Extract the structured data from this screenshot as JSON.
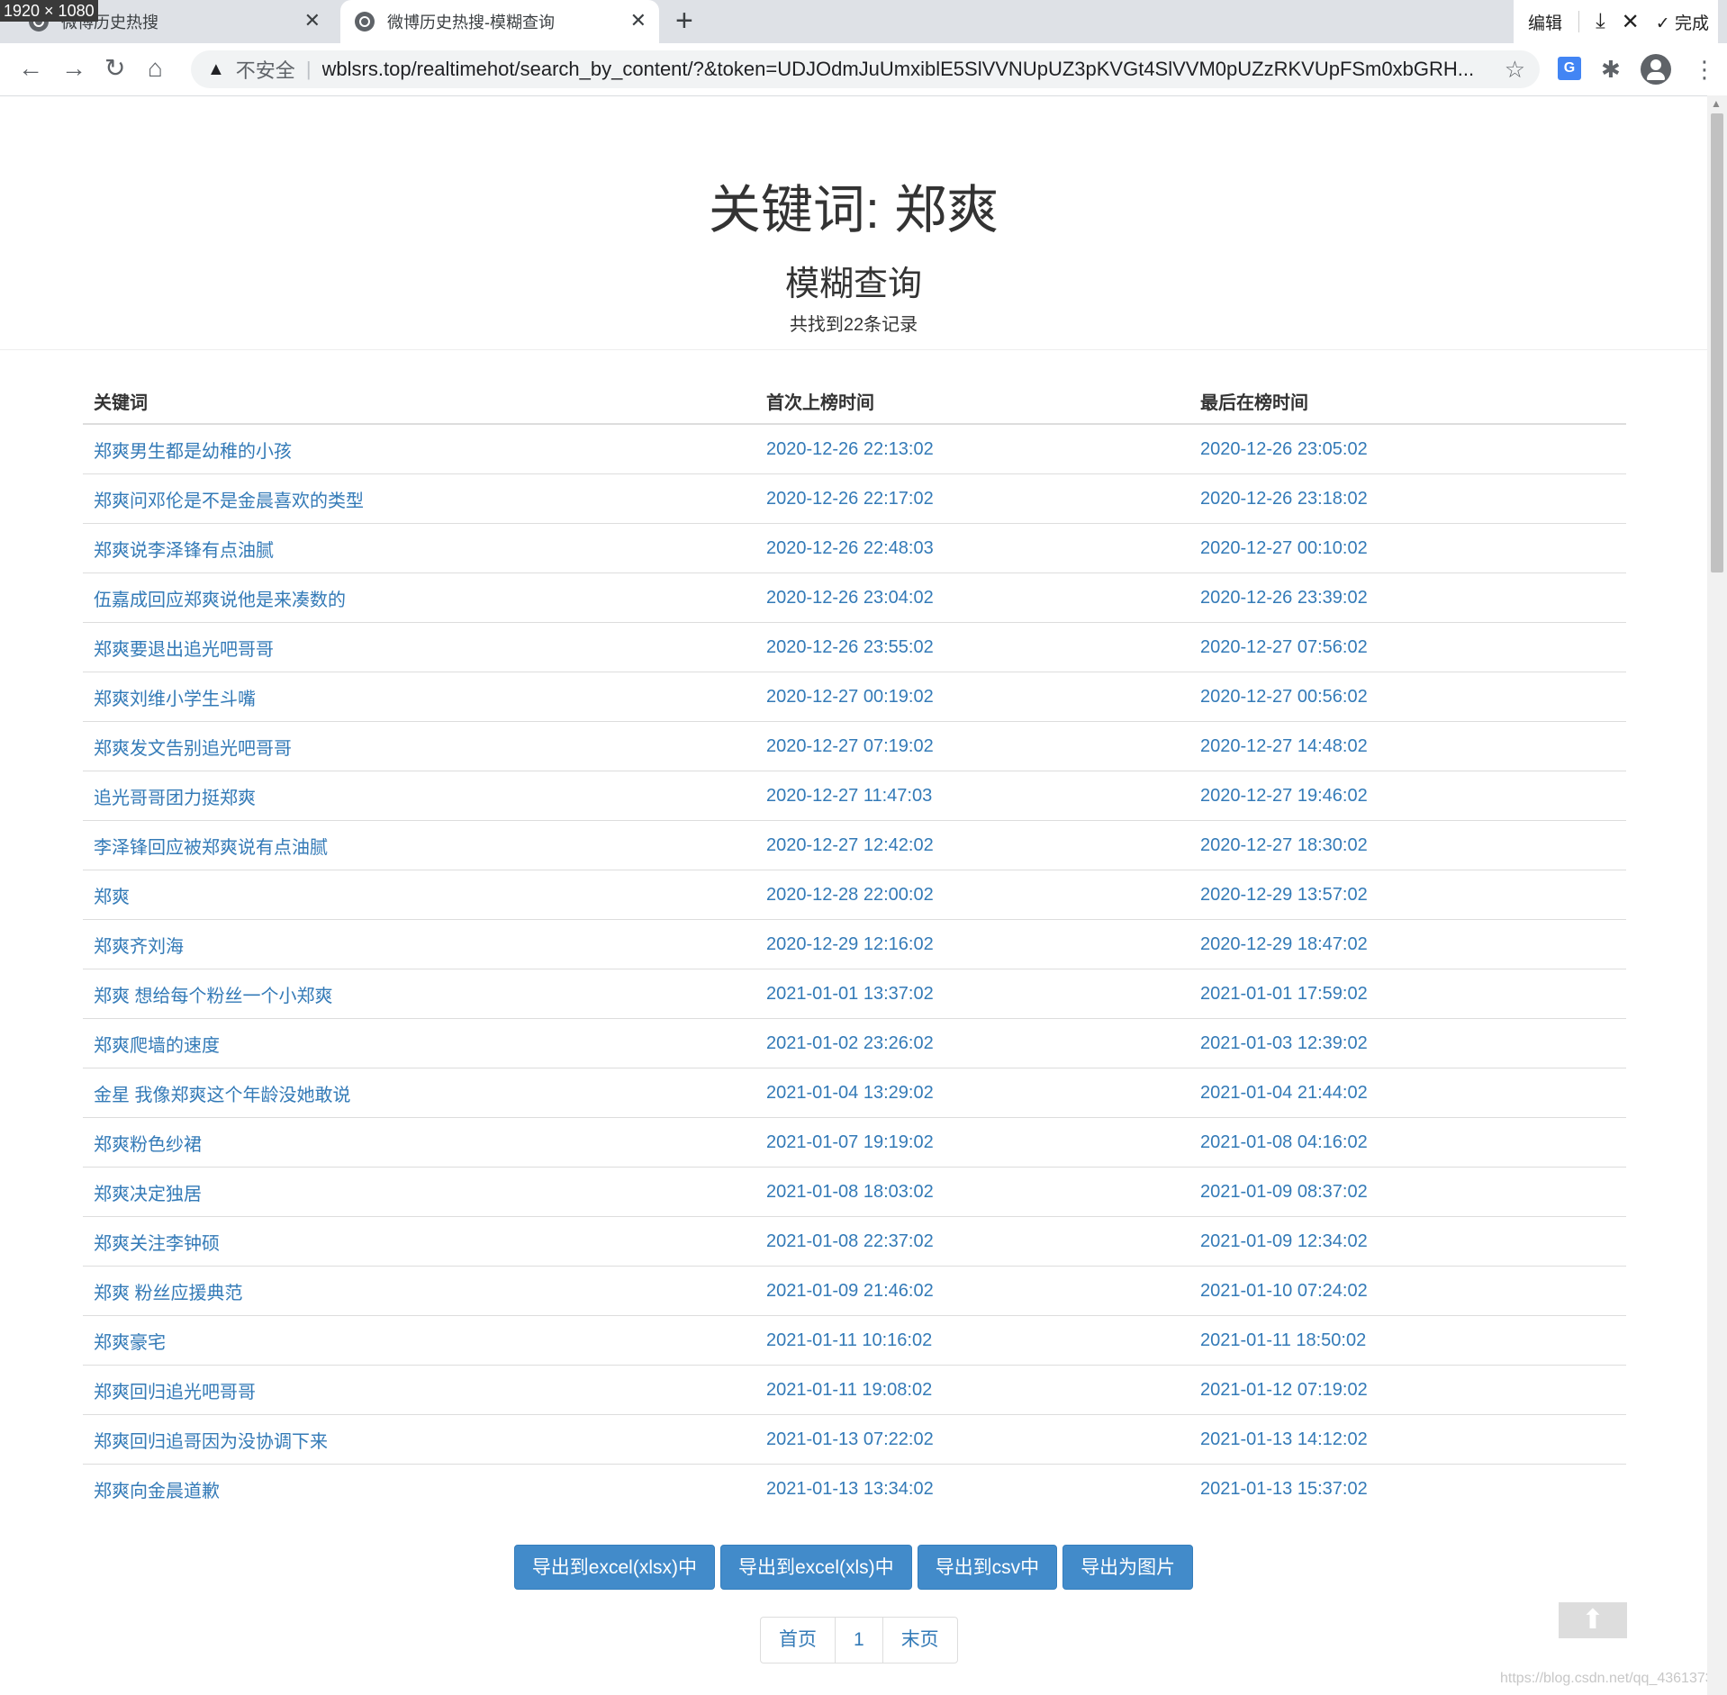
{
  "browser": {
    "dimension_badge": "1920 × 1080",
    "tabs": [
      {
        "title": "微博历史热搜",
        "active": false
      },
      {
        "title": "微博历史热搜-模糊查询",
        "active": true
      }
    ],
    "insecure_label": "不安全",
    "url": "wblsrs.top/realtimehot/search_by_content/?&token=UDJOdmJuUmxiblE5SlVVNUpUZ3pKVGt4SlVVM0pUZzRKVUpFSm0xbGRH...",
    "screenshot_tools": {
      "edit_label": "编辑",
      "done_label": "完成"
    }
  },
  "header": {
    "title": "关键词: 郑爽",
    "subtitle": "模糊查询",
    "record_count": "共找到22条记录"
  },
  "table": {
    "columns": [
      "关键词",
      "首次上榜时间",
      "最后在榜时间"
    ],
    "rows": [
      [
        "郑爽男生都是幼稚的小孩",
        "2020-12-26 22:13:02",
        "2020-12-26 23:05:02"
      ],
      [
        "郑爽问邓伦是不是金晨喜欢的类型",
        "2020-12-26 22:17:02",
        "2020-12-26 23:18:02"
      ],
      [
        "郑爽说李泽锋有点油腻",
        "2020-12-26 22:48:03",
        "2020-12-27 00:10:02"
      ],
      [
        "伍嘉成回应郑爽说他是来凑数的",
        "2020-12-26 23:04:02",
        "2020-12-26 23:39:02"
      ],
      [
        "郑爽要退出追光吧哥哥",
        "2020-12-26 23:55:02",
        "2020-12-27 07:56:02"
      ],
      [
        "郑爽刘维小学生斗嘴",
        "2020-12-27 00:19:02",
        "2020-12-27 00:56:02"
      ],
      [
        "郑爽发文告别追光吧哥哥",
        "2020-12-27 07:19:02",
        "2020-12-27 14:48:02"
      ],
      [
        "追光哥哥团力挺郑爽",
        "2020-12-27 11:47:03",
        "2020-12-27 19:46:02"
      ],
      [
        "李泽锋回应被郑爽说有点油腻",
        "2020-12-27 12:42:02",
        "2020-12-27 18:30:02"
      ],
      [
        "郑爽",
        "2020-12-28 22:00:02",
        "2020-12-29 13:57:02"
      ],
      [
        "郑爽齐刘海",
        "2020-12-29 12:16:02",
        "2020-12-29 18:47:02"
      ],
      [
        "郑爽 想给每个粉丝一个小郑爽",
        "2021-01-01 13:37:02",
        "2021-01-01 17:59:02"
      ],
      [
        "郑爽爬墙的速度",
        "2021-01-02 23:26:02",
        "2021-01-03 12:39:02"
      ],
      [
        "金星 我像郑爽这个年龄没她敢说",
        "2021-01-04 13:29:02",
        "2021-01-04 21:44:02"
      ],
      [
        "郑爽粉色纱裙",
        "2021-01-07 19:19:02",
        "2021-01-08 04:16:02"
      ],
      [
        "郑爽决定独居",
        "2021-01-08 18:03:02",
        "2021-01-09 08:37:02"
      ],
      [
        "郑爽关注李钟硕",
        "2021-01-08 22:37:02",
        "2021-01-09 12:34:02"
      ],
      [
        "郑爽 粉丝应援典范",
        "2021-01-09 21:46:02",
        "2021-01-10 07:24:02"
      ],
      [
        "郑爽豪宅",
        "2021-01-11 10:16:02",
        "2021-01-11 18:50:02"
      ],
      [
        "郑爽回归追光吧哥哥",
        "2021-01-11 19:08:02",
        "2021-01-12 07:19:02"
      ],
      [
        "郑爽回归追哥因为没协调下来",
        "2021-01-13 07:22:02",
        "2021-01-13 14:12:02"
      ],
      [
        "郑爽向金晨道歉",
        "2021-01-13 13:34:02",
        "2021-01-13 15:37:02"
      ]
    ]
  },
  "export_buttons": [
    "导出到excel(xlsx)中",
    "导出到excel(xls)中",
    "导出到csv中",
    "导出为图片"
  ],
  "pagination": {
    "first": "首页",
    "current": "1",
    "last": "末页"
  },
  "watermark": "https://blog.csdn.net/qq_4361373",
  "colors": {
    "link": "#337ab7",
    "button": "#428bca"
  }
}
